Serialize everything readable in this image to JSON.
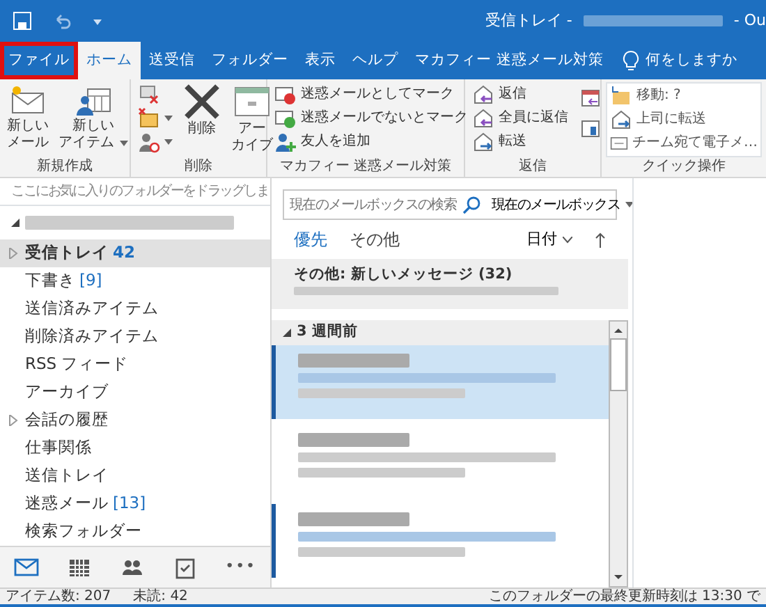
{
  "window": {
    "title": "受信トレイ -",
    "title_tail": "- Ou"
  },
  "tabs": [
    {
      "label": "ファイル",
      "selected": false,
      "highlighted": true
    },
    {
      "label": "ホーム",
      "selected": true,
      "highlighted": false
    },
    {
      "label": "送受信",
      "selected": false,
      "highlighted": false
    },
    {
      "label": "フォルダー",
      "selected": false,
      "highlighted": false
    },
    {
      "label": "表示",
      "selected": false,
      "highlighted": false
    },
    {
      "label": "ヘルプ",
      "selected": false,
      "highlighted": false
    },
    {
      "label": "マカフィー 迷惑メール対策",
      "selected": false,
      "highlighted": false
    }
  ],
  "tell_me": "何をしますか",
  "ribbon": {
    "new": {
      "label": "新規作成",
      "buttons": [
        {
          "lines": [
            "新しい",
            "メール"
          ],
          "caret": false
        },
        {
          "lines": [
            "新しい",
            "アイテム"
          ],
          "caret": true
        }
      ]
    },
    "delete": {
      "label": "削除",
      "delete": "削除",
      "archive": [
        "アー",
        "カイブ"
      ]
    },
    "mcafee": {
      "label": "マカフィー 迷惑メール対策",
      "buttons": [
        "迷惑メールとしてマーク",
        "迷惑メールでないとマーク",
        "友人を追加"
      ]
    },
    "respond": {
      "label": "返信",
      "buttons": [
        "返信",
        "全員に返信",
        "転送"
      ]
    },
    "quick": {
      "label": "クイック操作",
      "buttons": [
        "移動: ?",
        "上司に転送",
        "チーム宛て電子メ…"
      ]
    }
  },
  "folder_pane": {
    "favorites_hint": "ここにお気に入りのフォルダーをドラッグしま",
    "folders": [
      {
        "name": "受信トレイ",
        "count": "42",
        "expandable": true,
        "selected": true,
        "unread": true
      },
      {
        "name": "下書き",
        "count": "[9]",
        "expandable": false,
        "selected": false,
        "unread": false
      },
      {
        "name": "送信済みアイテム",
        "expandable": false,
        "selected": false,
        "unread": false
      },
      {
        "name": "削除済みアイテム",
        "expandable": false,
        "selected": false,
        "unread": false
      },
      {
        "name": "RSS フィード",
        "expandable": false,
        "selected": false,
        "unread": false
      },
      {
        "name": "アーカイブ",
        "expandable": false,
        "selected": false,
        "unread": false
      },
      {
        "name": "会話の履歴",
        "expandable": true,
        "selected": false,
        "unread": false
      },
      {
        "name": "仕事関係",
        "expandable": false,
        "selected": false,
        "unread": false
      },
      {
        "name": "送信トレイ",
        "expandable": false,
        "selected": false,
        "unread": false
      },
      {
        "name": "迷惑メール",
        "count": "[13]",
        "expandable": false,
        "selected": false,
        "unread": false
      },
      {
        "name": "検索フォルダー",
        "expandable": false,
        "selected": false,
        "unread": false
      }
    ],
    "nav": [
      {
        "kind": "mail",
        "selected": true
      },
      {
        "kind": "calendar",
        "selected": false
      },
      {
        "kind": "people",
        "selected": false
      },
      {
        "kind": "tasks",
        "selected": false
      },
      {
        "kind": "more",
        "label": "•••",
        "selected": false
      }
    ]
  },
  "message_list": {
    "search_placeholder": "現在のメールボックスの検索",
    "scope": "現在のメールボックス",
    "tabs": [
      {
        "label": "優先",
        "selected": true
      },
      {
        "label": "その他",
        "selected": false
      }
    ],
    "sort": "日付",
    "other_banner": "その他: 新しいメッセージ (32)",
    "group": "3 週間前",
    "messages": [
      {
        "selected": true,
        "unread": true
      },
      {
        "selected": false,
        "unread": false
      },
      {
        "selected": false,
        "unread": true
      }
    ]
  },
  "status_bar": {
    "items": "アイテム数: 207",
    "unread": "未読: 42",
    "updated": "このフォルダーの最終更新時刻は 13:30 で"
  }
}
